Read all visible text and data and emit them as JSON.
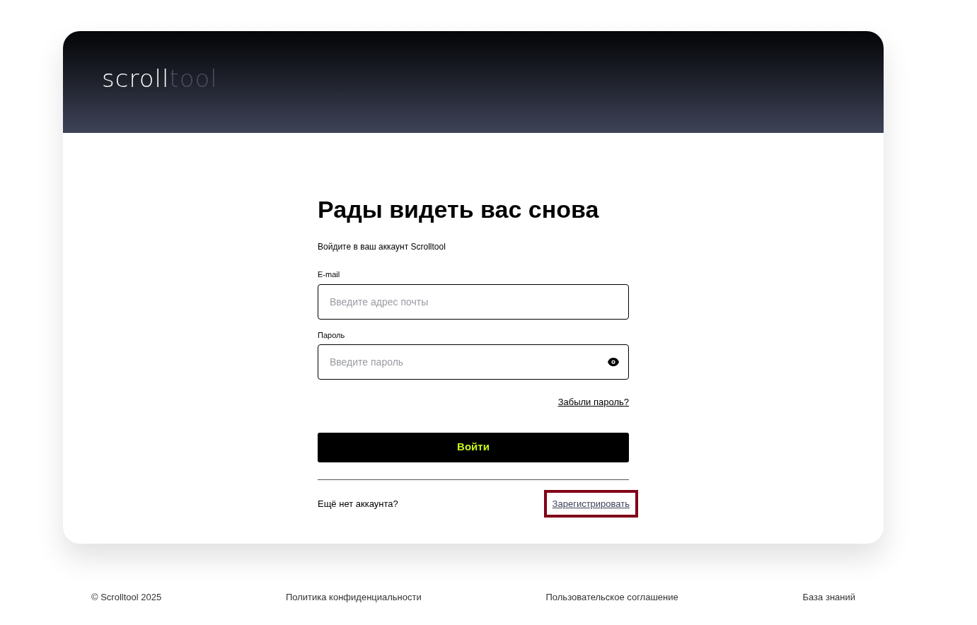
{
  "header": {
    "logo": {
      "light": "scroll",
      "dim": "tool"
    }
  },
  "form": {
    "title": "Рады видеть вас снова",
    "subtitle": "Войдите в ваш аккаунт Scrolltool",
    "fields": [
      {
        "kind": "email",
        "label": "E-mail",
        "placeholder": "Введите адрес почты"
      },
      {
        "kind": "password",
        "label": "Пароль",
        "placeholder": "Введите пароль"
      }
    ],
    "forgot_link": "Забыли пароль?",
    "submit": "Войти",
    "signup_prompt": "Ещё нет аккаунта?",
    "signup_link": {
      "label": "Зарегистрировать",
      "focused": true
    }
  },
  "footer": [
    "© Scrolltool 2025",
    "Политика конфиденциальности",
    "Пользовательское соглашение",
    "База знаний"
  ]
}
